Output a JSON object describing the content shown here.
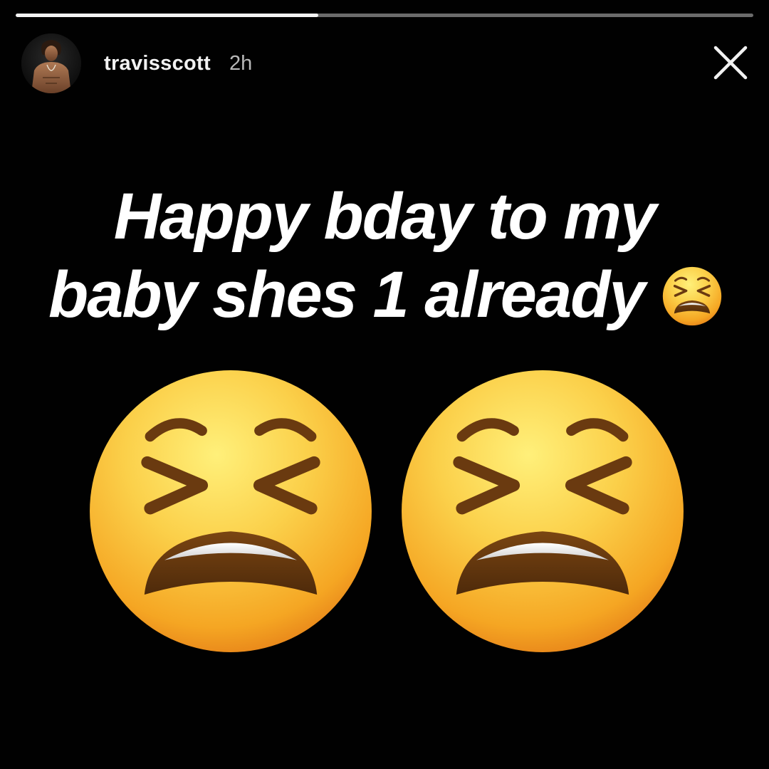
{
  "story": {
    "progress": 0.41,
    "username": "travisscott",
    "timestamp": "2h",
    "caption": {
      "line1": "Happy bday to my",
      "line2": "baby shes 1 already"
    }
  },
  "icons": {
    "close": "close-icon",
    "avatar": "profile-avatar",
    "stickers": [
      "tired-face-emoji",
      "tired-face-emoji",
      "tired-face-emoji"
    ]
  },
  "colors": {
    "background": "#010101",
    "progress_fill": "#f4f4f4",
    "progress_track": "rgba(255,255,255,0.42)",
    "emoji_yellow": "#fbd04a",
    "emoji_orange": "#f29a1d",
    "emoji_feature": "#6a3a10"
  }
}
